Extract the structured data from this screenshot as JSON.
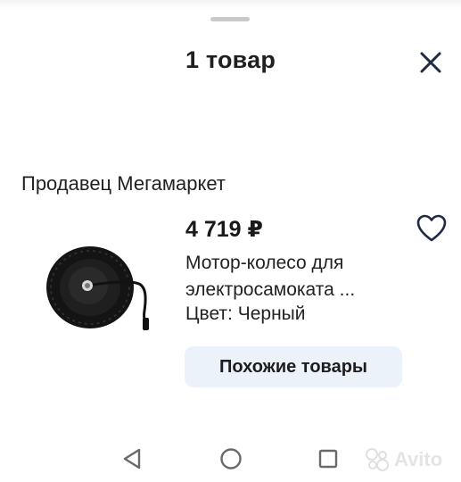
{
  "sheet": {
    "title": "1 товар"
  },
  "seller": {
    "label": "Продавец Мегамаркет"
  },
  "product": {
    "price": "4 719 ₽",
    "name_line1": "Мотор-колесо для",
    "name_line2": "электросамоката ...",
    "color": "Цвет: Черный",
    "similar_button": "Похожие товары"
  },
  "icons": {
    "close": "close-icon",
    "favorite": "heart-icon",
    "back": "back-triangle-icon",
    "home": "home-circle-icon",
    "recents": "recents-square-icon"
  },
  "watermark": {
    "text": "Avito"
  },
  "colors": {
    "accent_bg": "#ebf2f9",
    "text": "#1f1f1f",
    "icon": "#1f2a44"
  }
}
